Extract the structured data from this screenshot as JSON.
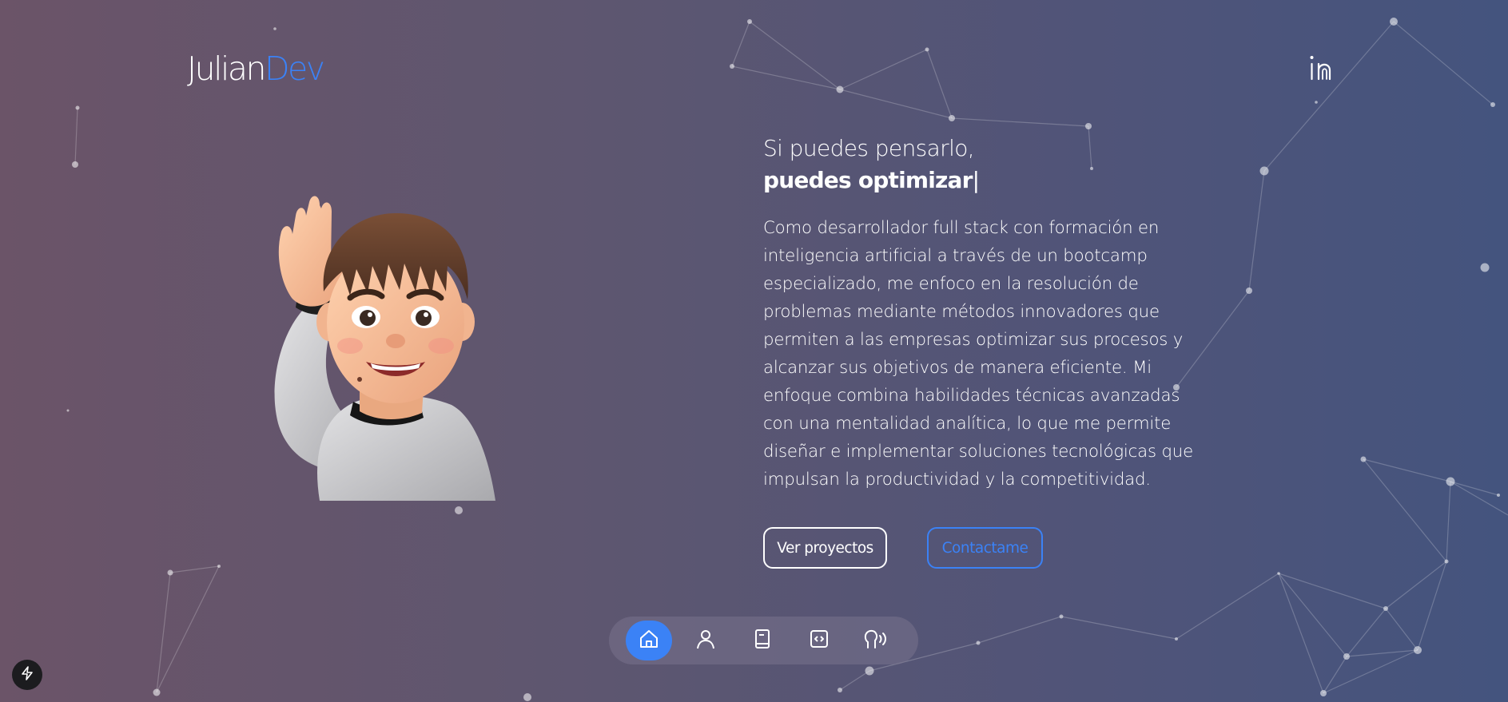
{
  "brand": {
    "name_part1": "Julian",
    "name_part2": "Dev",
    "accent_color": "#3b82f6"
  },
  "header": {
    "social_icon": "linkedin-icon"
  },
  "hero": {
    "headline_line1": "Si puedes pensarlo,",
    "headline_line2": "puedes optimizar",
    "cursor": "|",
    "description": "Como desarrollador full stack con formación en inteligencia artificial a través de un bootcamp especializado, me enfoco en la resolución de problemas mediante métodos innovadores que permiten a las empresas optimizar sus procesos y alcanzar sus objetivos de manera eficiente. Mi enfoque combina habilidades técnicas avanzadas con una mentalidad analítica, lo que me permite diseñar e implementar soluciones tecnológicas que impulsan la productividad y la competitividad.",
    "avatar_icon": "waving-memoji-avatar"
  },
  "buttons": {
    "projects_label": "Ver proyectos",
    "contact_label": "Contactame"
  },
  "dock": {
    "items": [
      {
        "icon": "home-icon",
        "active": true
      },
      {
        "icon": "user-icon",
        "active": false
      },
      {
        "icon": "book-icon",
        "active": false
      },
      {
        "icon": "code-icon",
        "active": false
      },
      {
        "icon": "voice-icon",
        "active": false
      }
    ]
  },
  "floating_button": {
    "icon": "lightning-icon"
  }
}
